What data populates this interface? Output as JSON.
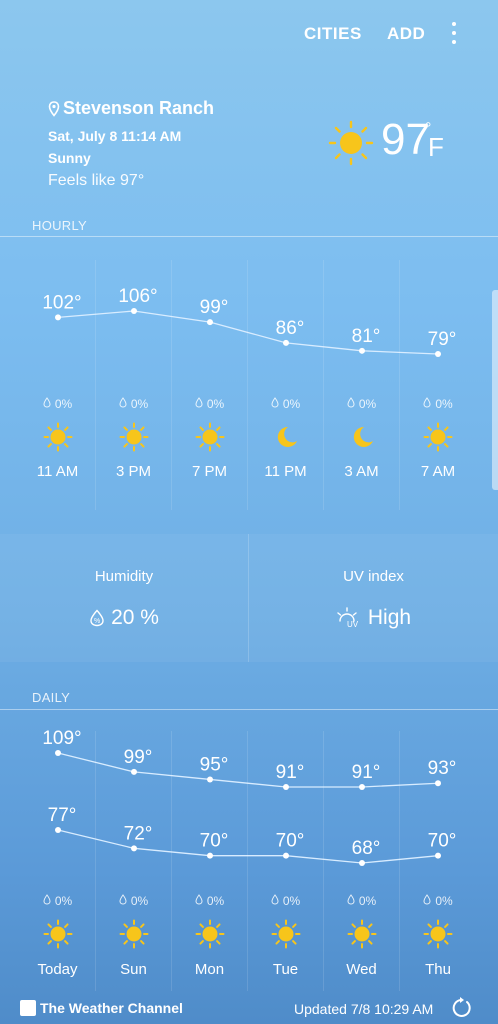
{
  "topbar": {
    "cities": "CITIES",
    "add": "ADD"
  },
  "current": {
    "location": "Stevenson Ranch",
    "datetime": "Sat, July 8 11:14 AM",
    "condition": "Sunny",
    "feels_like": "Feels like 97°",
    "temp": "97",
    "degree": "°",
    "unit": "F",
    "icon": "sun-icon"
  },
  "hourly": {
    "label": "HOURLY",
    "items": [
      {
        "time": "11 AM",
        "temp": 102,
        "precip": "0%",
        "icon": "sun"
      },
      {
        "time": "3 PM",
        "temp": 106,
        "precip": "0%",
        "icon": "sun"
      },
      {
        "time": "7 PM",
        "temp": 99,
        "precip": "0%",
        "icon": "sun"
      },
      {
        "time": "11 PM",
        "temp": 86,
        "precip": "0%",
        "icon": "moon"
      },
      {
        "time": "3 AM",
        "temp": 81,
        "precip": "0%",
        "icon": "moon"
      },
      {
        "time": "7 AM",
        "temp": 79,
        "precip": "0%",
        "icon": "sun"
      }
    ]
  },
  "details": {
    "humidity_label": "Humidity",
    "humidity_value": "20 %",
    "uv_label": "UV index",
    "uv_value": "High"
  },
  "daily": {
    "label": "DAILY",
    "items": [
      {
        "day": "Today",
        "high": 109,
        "low": 77,
        "precip": "0%",
        "icon": "sun"
      },
      {
        "day": "Sun",
        "high": 99,
        "low": 72,
        "precip": "0%",
        "icon": "sun"
      },
      {
        "day": "Mon",
        "high": 95,
        "low": 70,
        "precip": "0%",
        "icon": "sun"
      },
      {
        "day": "Tue",
        "high": 91,
        "low": 70,
        "precip": "0%",
        "icon": "sun"
      },
      {
        "day": "Wed",
        "high": 91,
        "low": 68,
        "precip": "0%",
        "icon": "sun"
      },
      {
        "day": "Thu",
        "high": 93,
        "low": 70,
        "precip": "0%",
        "icon": "sun"
      }
    ]
  },
  "footer": {
    "brand": "The Weather Channel",
    "updated": "Updated  7/8  10:29 AM"
  },
  "colors": {
    "sun": "#f7c51b",
    "moon": "#f7c51b",
    "line": "#d8ecff"
  }
}
